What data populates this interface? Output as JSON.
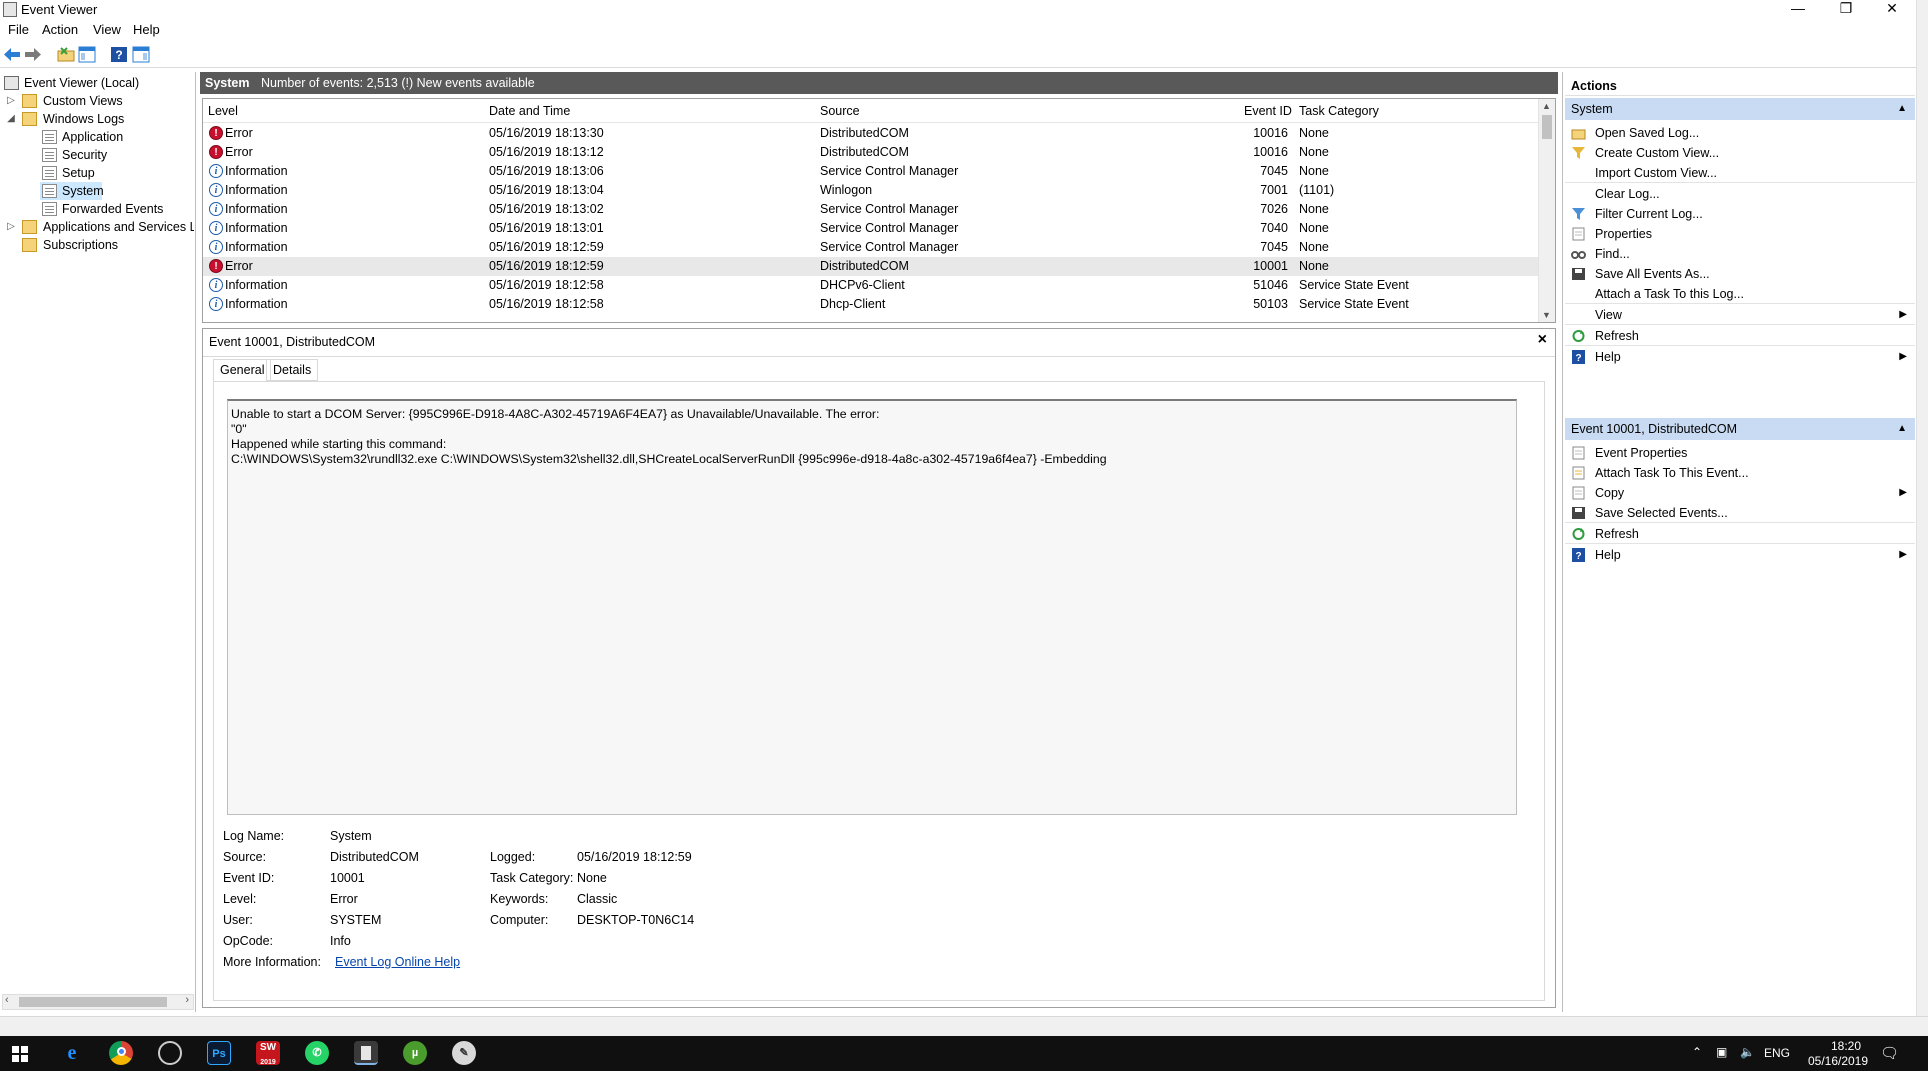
{
  "window": {
    "title": "Event Viewer"
  },
  "menu": [
    "File",
    "Action",
    "View",
    "Help"
  ],
  "tree": {
    "root": "Event Viewer (Local)",
    "custom_views": "Custom Views",
    "windows_logs": "Windows Logs",
    "logs": [
      "Application",
      "Security",
      "Setup",
      "System",
      "Forwarded Events"
    ],
    "apps_services": "Applications and Services Lo",
    "subscriptions": "Subscriptions"
  },
  "center": {
    "log_name": "System",
    "event_count": "Number of events: 2,513 (!) New events available"
  },
  "grid": {
    "columns": [
      "Level",
      "Date and Time",
      "Source",
      "Event ID",
      "Task Category"
    ],
    "rows": [
      {
        "level": "Error",
        "type": "err",
        "date": "05/16/2019 18:13:30",
        "source": "DistributedCOM",
        "id": "10016",
        "category": "None"
      },
      {
        "level": "Error",
        "type": "err",
        "date": "05/16/2019 18:13:12",
        "source": "DistributedCOM",
        "id": "10016",
        "category": "None"
      },
      {
        "level": "Information",
        "type": "info",
        "date": "05/16/2019 18:13:06",
        "source": "Service Control Manager",
        "id": "7045",
        "category": "None"
      },
      {
        "level": "Information",
        "type": "info",
        "date": "05/16/2019 18:13:04",
        "source": "Winlogon",
        "id": "7001",
        "category": "(1101)"
      },
      {
        "level": "Information",
        "type": "info",
        "date": "05/16/2019 18:13:02",
        "source": "Service Control Manager",
        "id": "7026",
        "category": "None"
      },
      {
        "level": "Information",
        "type": "info",
        "date": "05/16/2019 18:13:01",
        "source": "Service Control Manager",
        "id": "7040",
        "category": "None"
      },
      {
        "level": "Information",
        "type": "info",
        "date": "05/16/2019 18:12:59",
        "source": "Service Control Manager",
        "id": "7045",
        "category": "None"
      },
      {
        "level": "Error",
        "type": "err",
        "date": "05/16/2019 18:12:59",
        "source": "DistributedCOM",
        "id": "10001",
        "category": "None"
      },
      {
        "level": "Information",
        "type": "info",
        "date": "05/16/2019 18:12:58",
        "source": "DHCPv6-Client",
        "id": "51046",
        "category": "Service State Event"
      },
      {
        "level": "Information",
        "type": "info",
        "date": "05/16/2019 18:12:58",
        "source": "Dhcp-Client",
        "id": "50103",
        "category": "Service State Event"
      }
    ]
  },
  "detail": {
    "title": "Event 10001, DistributedCOM",
    "tabs": [
      "General",
      "Details"
    ],
    "description": [
      "Unable to start a DCOM Server: {995C996E-D918-4A8C-A302-45719A6F4EA7} as Unavailable/Unavailable. The error:",
      "\"0\"",
      "Happened while starting this command:",
      "C:\\WINDOWS\\System32\\rundll32.exe C:\\WINDOWS\\System32\\shell32.dll,SHCreateLocalServerRunDll {995c996e-d918-4a8c-a302-45719a6f4ea7} -Embedding"
    ],
    "labels": {
      "log_name": "Log Name:",
      "source": "Source:",
      "event_id": "Event ID:",
      "level": "Level:",
      "user": "User:",
      "opcode": "OpCode:",
      "more_info": "More Information:",
      "logged": "Logged:",
      "task_category": "Task Category:",
      "keywords": "Keywords:",
      "computer": "Computer:"
    },
    "values": {
      "log_name": "System",
      "source": "DistributedCOM",
      "event_id": "10001",
      "level": "Error",
      "user": "SYSTEM",
      "opcode": "Info",
      "more_info": "Event Log Online Help",
      "logged": "05/16/2019 18:12:59",
      "task_category": "None",
      "keywords": "Classic",
      "computer": "DESKTOP-T0N6C14"
    }
  },
  "actions": {
    "title": "Actions",
    "section1": "System",
    "items1": [
      "Open Saved Log...",
      "Create Custom View...",
      "Import Custom View...",
      "Clear Log...",
      "Filter Current Log...",
      "Properties",
      "Find...",
      "Save All Events As...",
      "Attach a Task To this Log...",
      "View",
      "Refresh",
      "Help"
    ],
    "section2": "Event 10001, DistributedCOM",
    "items2": [
      "Event Properties",
      "Attach Task To This Event...",
      "Copy",
      "Save Selected Events...",
      "Refresh",
      "Help"
    ]
  },
  "taskbar": {
    "lang": "ENG",
    "time": "18:20",
    "date": "05/16/2019",
    "sw_label": "SW",
    "sw_year": "2019",
    "ps_label": "Ps"
  },
  "colors": {
    "selection": "#cce8ff",
    "section": "#c9dbf2",
    "header": "#595959",
    "error": "#c8102e",
    "info": "#1d5da8"
  }
}
